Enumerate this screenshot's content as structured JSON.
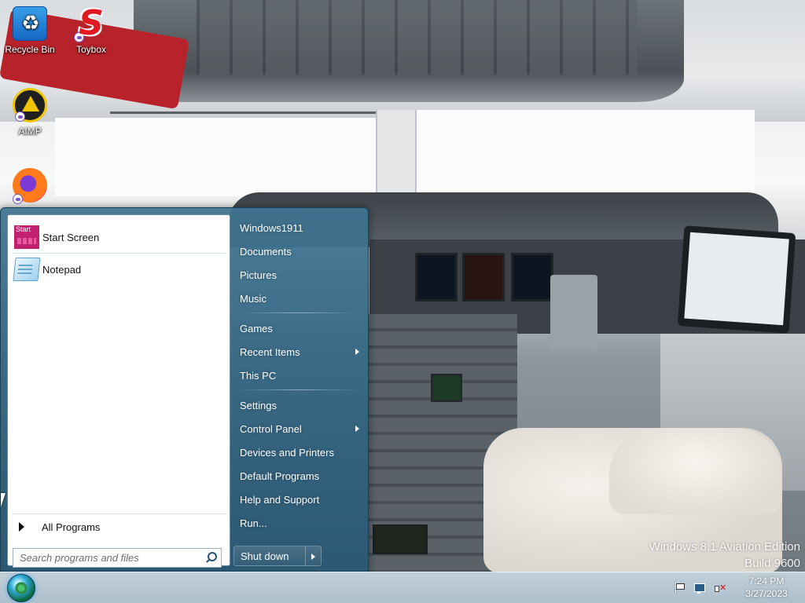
{
  "desktop": {
    "icons": [
      {
        "label": "Recycle Bin",
        "icon": "recycle-bin-icon"
      },
      {
        "label": "Toybox",
        "icon": "toybox-icon"
      },
      {
        "label": "AIMP",
        "icon": "aimp-icon"
      },
      {
        "label": "",
        "icon": "firefox-icon"
      }
    ],
    "watermark": {
      "line1": "Windows 8.1 Aviation Edition",
      "line2": "Build 9600"
    }
  },
  "start_menu": {
    "pinned": [
      {
        "label": "Start Screen",
        "icon": "start-screen-icon"
      },
      {
        "label": "Notepad",
        "icon": "notepad-icon"
      }
    ],
    "all_programs_label": "All Programs",
    "search_placeholder": "Search programs and files",
    "right_items": [
      {
        "label": "Windows1911"
      },
      {
        "label": "Documents"
      },
      {
        "label": "Pictures"
      },
      {
        "label": "Music"
      },
      {
        "label": "Games"
      },
      {
        "label": "Recent Items",
        "has_submenu": true
      },
      {
        "label": "This PC"
      },
      {
        "label": "Settings"
      },
      {
        "label": "Control Panel",
        "has_submenu": true
      },
      {
        "label": "Devices and Printers"
      },
      {
        "label": "Default Programs"
      },
      {
        "label": "Help and Support"
      },
      {
        "label": "Run..."
      }
    ],
    "shutdown_label": "Shut down"
  },
  "taskbar": {
    "tray_icons": [
      "flag-icon",
      "network-icon",
      "volume-muted-icon"
    ],
    "clock": {
      "time": "7:24 PM",
      "date": "3/27/2023"
    }
  },
  "colors": {
    "start_menu_bg": "#2f6a8a",
    "taskbar_bg": "#b6c8d6",
    "left_pane_bg": "#ffffff"
  }
}
